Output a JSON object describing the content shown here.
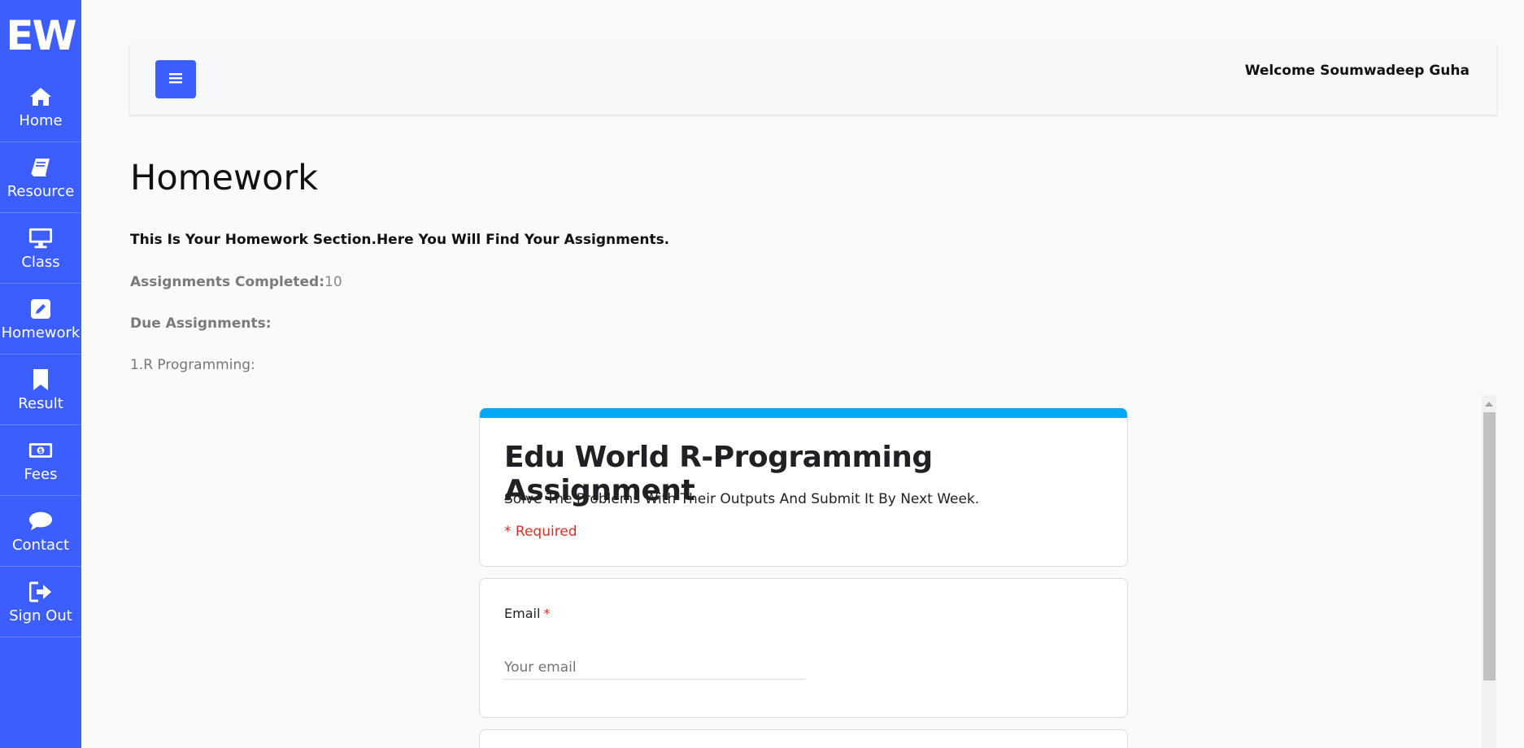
{
  "sidebar": {
    "logo": "EW",
    "items": [
      {
        "label": "Home",
        "icon": "home-icon"
      },
      {
        "label": "Resource",
        "icon": "book-icon"
      },
      {
        "label": "Class",
        "icon": "monitor-icon"
      },
      {
        "label": "Homework",
        "icon": "edit-icon"
      },
      {
        "label": "Result",
        "icon": "bookmark-icon"
      },
      {
        "label": "Fees",
        "icon": "money-icon"
      },
      {
        "label": "Contact",
        "icon": "chat-icon"
      },
      {
        "label": "Sign Out",
        "icon": "sign-out-icon"
      }
    ]
  },
  "topbar": {
    "menu_icon": "menu-icon",
    "welcome": "Welcome Soumwadeep Guha"
  },
  "main": {
    "title": "Homework",
    "intro": "This Is Your Homework Section.Here You Will Find Your Assignments.",
    "completed_label": "Assignments Completed:",
    "completed_count": "10",
    "due_label": "Due Assignments:",
    "due_items": [
      "1.R Programming:"
    ]
  },
  "form": {
    "title": "Edu World R-Programming Assignment",
    "description": "Solve The Problems With Their Outputs And Submit It By Next Week.",
    "required_note": "* Required",
    "email_label": "Email",
    "required_star": "*",
    "email_placeholder": "Your email"
  },
  "colors": {
    "sidebar": "#3d5eff",
    "accent_bar": "#03a9f4",
    "required": "#d93025"
  }
}
